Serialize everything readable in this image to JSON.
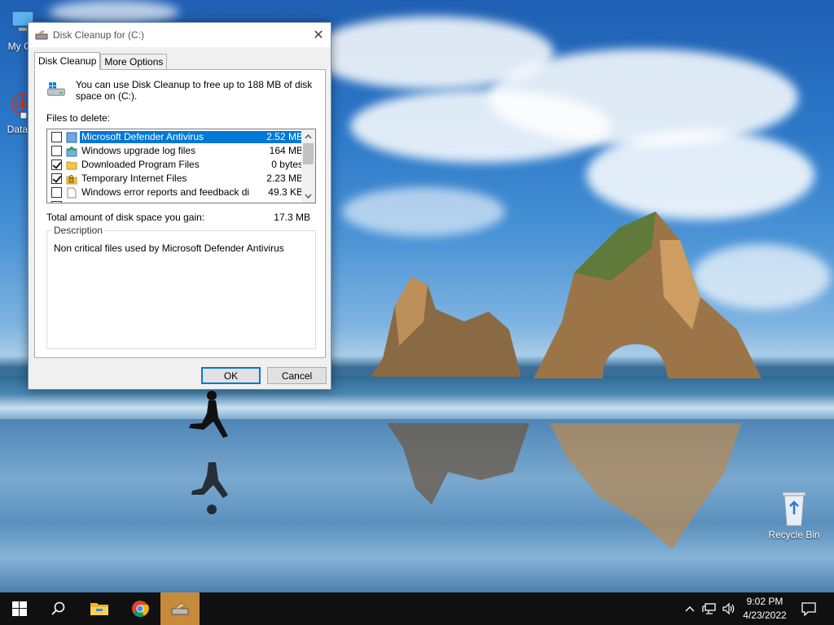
{
  "desktop": {
    "icons": [
      {
        "label": "My Co"
      },
      {
        "label": "DataW"
      },
      {
        "label": "Recycle Bin"
      }
    ]
  },
  "dialog": {
    "title": "Disk Cleanup for  (C:)",
    "tabs": [
      {
        "label": "Disk Cleanup",
        "active": true
      },
      {
        "label": "More Options",
        "active": false
      }
    ],
    "intro_text": "You can use Disk Cleanup to free up to 188 MB of disk space on  (C:).",
    "files_label": "Files to delete:",
    "files": [
      {
        "name": "Microsoft Defender Antivirus",
        "size": "2.52 MB",
        "checked": false,
        "selected": true,
        "icon": "defender-icon"
      },
      {
        "name": "Windows upgrade log files",
        "size": "164 MB",
        "checked": false,
        "selected": false,
        "icon": "log-files-icon"
      },
      {
        "name": "Downloaded Program Files",
        "size": "0 bytes",
        "checked": true,
        "selected": false,
        "icon": "folder-icon"
      },
      {
        "name": "Temporary Internet Files",
        "size": "2.23 MB",
        "checked": true,
        "selected": false,
        "icon": "lock-folder-icon"
      },
      {
        "name": "Windows error reports and feedback di...",
        "size": "49.3 KB",
        "checked": false,
        "selected": false,
        "icon": "document-icon"
      }
    ],
    "total_label": "Total amount of disk space you gain:",
    "total_value": "17.3 MB",
    "description_legend": "Description",
    "description_text": "Non critical files used by Microsoft Defender Antivirus",
    "ok_label": "OK",
    "cancel_label": "Cancel",
    "close_glyph": "✕"
  },
  "taskbar": {
    "time": "9:02 PM",
    "date": "4/23/2022",
    "colors": {
      "active_app": "#c68a3a",
      "background": "#101010"
    }
  }
}
